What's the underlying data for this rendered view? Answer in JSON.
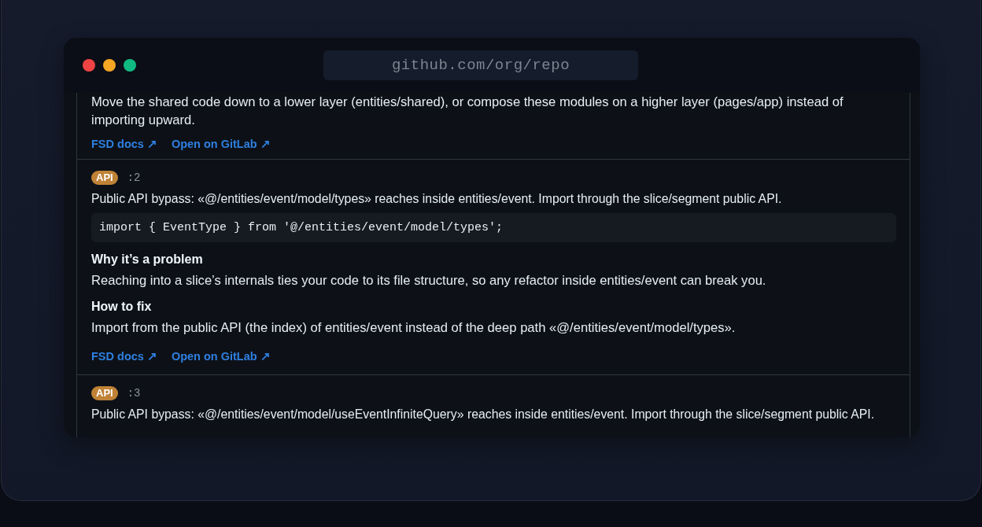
{
  "window": {
    "url": "github.com/org/repo"
  },
  "issues": [
    {
      "sections": [
        {
          "text": "Move the shared code down to a lower layer (entities/shared), or compose these modules on a higher layer (pages/app) instead of importing upward."
        }
      ],
      "links": [
        {
          "label": "FSD docs ↗"
        },
        {
          "label": "Open on GitLab ↗"
        }
      ]
    },
    {
      "badge": "API",
      "line": ":2",
      "message": "Public API bypass: «@/entities/event/model/types» reaches inside entities/event. Import through the slice/segment public API.",
      "code": "import { EventType } from '@/entities/event/model/types';",
      "sections": [
        {
          "heading": "Why it’s a problem",
          "text": "Reaching into a slice’s internals ties your code to its file structure, so any refactor inside entities/event can break you."
        },
        {
          "heading": "How to fix",
          "text": "Import from the public API (the index) of entities/event instead of the deep path «@/entities/event/model/types»."
        }
      ],
      "links": [
        {
          "label": "FSD docs ↗"
        },
        {
          "label": "Open on GitLab ↗"
        }
      ]
    },
    {
      "badge": "API",
      "line": ":3",
      "message": "Public API bypass: «@/entities/event/model/useEventInfiniteQuery» reaches inside entities/event. Import through the slice/segment public API."
    }
  ]
}
